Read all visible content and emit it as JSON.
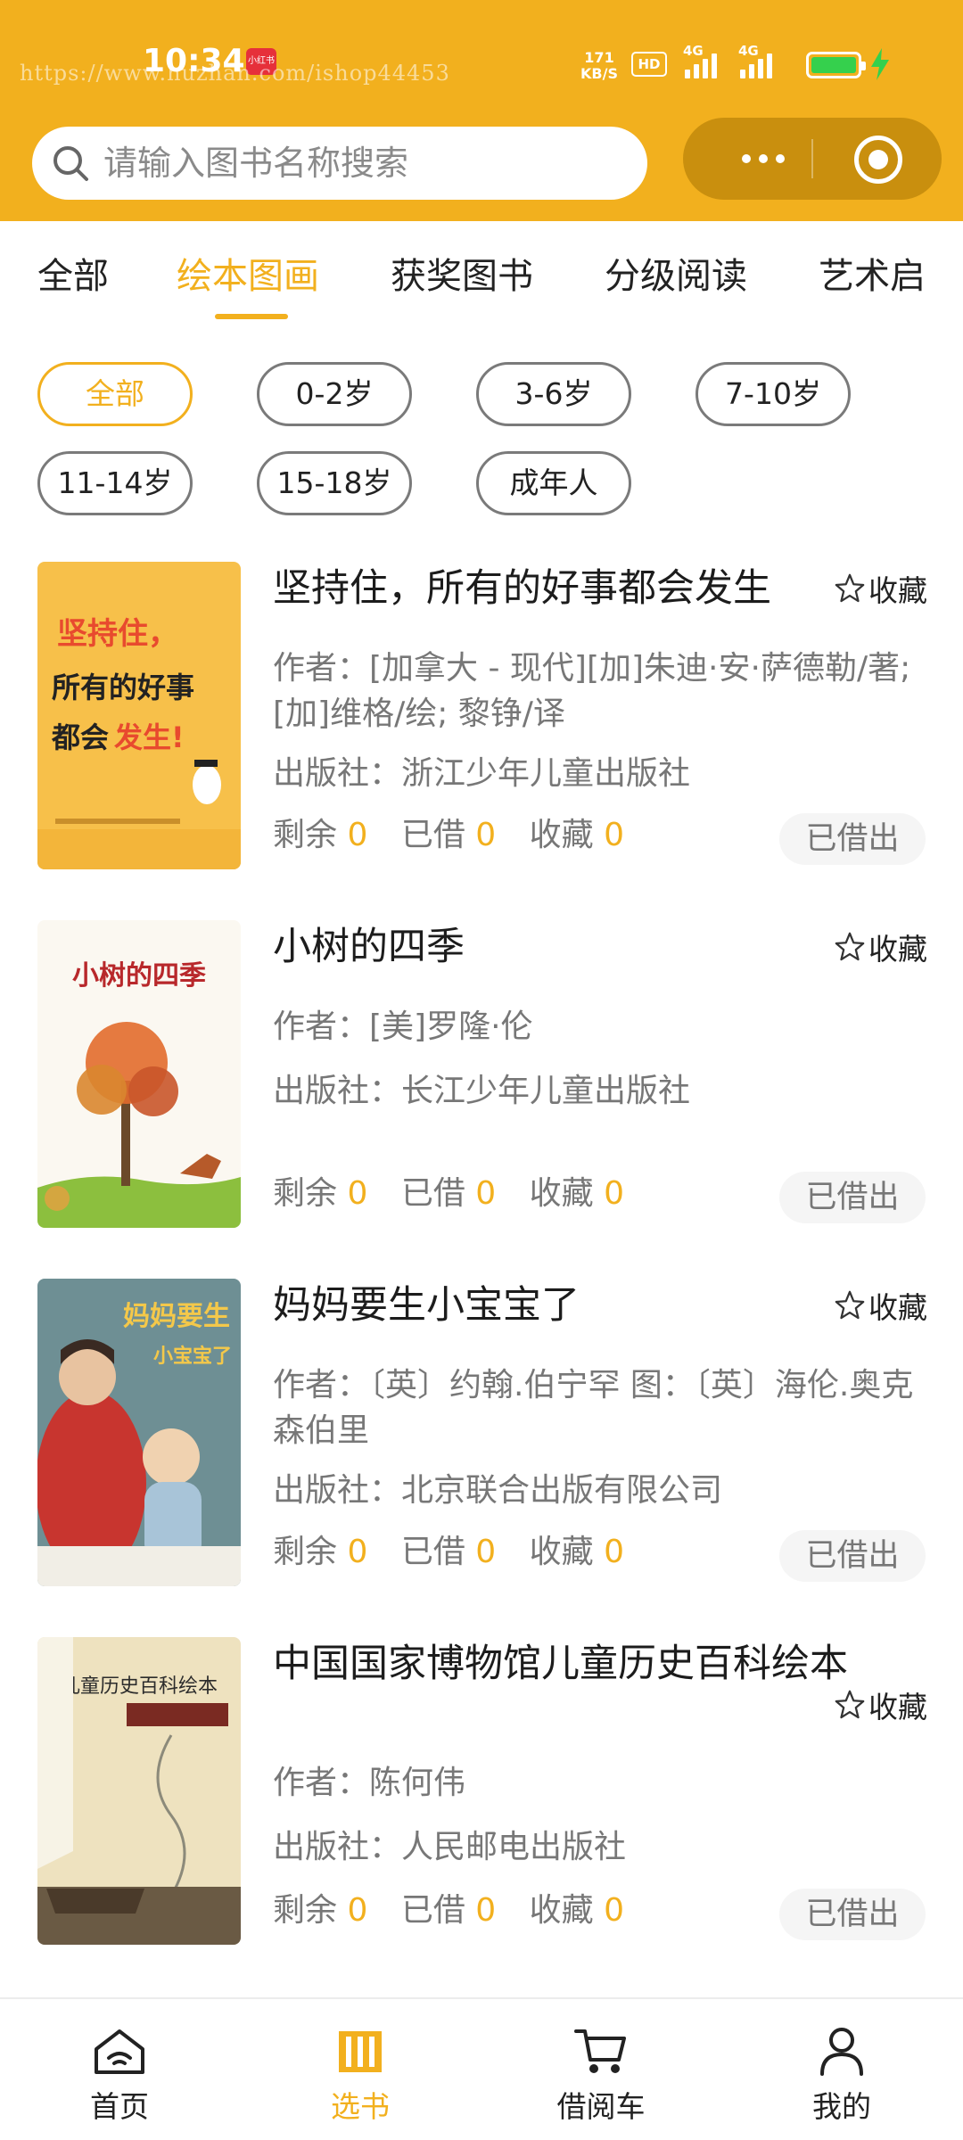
{
  "status_bar": {
    "time": "10:34",
    "app_badge": "小红书",
    "watermark": "https://www.huzhan.com/ishop44453",
    "net_speed_value": "171",
    "net_speed_unit": "KB/S",
    "hd_label": "HD",
    "signal1_label": "4G",
    "signal2_label": "4G",
    "battery_level": 1.0
  },
  "search": {
    "placeholder": "请输入图书名称搜索"
  },
  "tabs": [
    {
      "label": "全部",
      "active": false
    },
    {
      "label": "绘本图画",
      "active": true
    },
    {
      "label": "获奖图书",
      "active": false
    },
    {
      "label": "分级阅读",
      "active": false
    },
    {
      "label": "艺术启",
      "active": false
    }
  ],
  "age_filters": [
    {
      "label": "全部",
      "active": true
    },
    {
      "label": "0-2岁",
      "active": false
    },
    {
      "label": "3-6岁",
      "active": false
    },
    {
      "label": "7-10岁",
      "active": false
    },
    {
      "label": "11-14岁",
      "active": false
    },
    {
      "label": "15-18岁",
      "active": false
    },
    {
      "label": "成年人",
      "active": false
    }
  ],
  "labels": {
    "favorite": "收藏",
    "remaining": "剩余",
    "borrowed": "已借",
    "favorites": "收藏",
    "lent_out": "已借出"
  },
  "books": [
    {
      "title": "坚持住，所有的好事都会发生",
      "author": "作者：[加拿大 - 现代][加]朱迪·安·萨德勒/著; [加]维格/绘; 黎铮/译",
      "publisher": "出版社：浙江少年儿童出版社",
      "remaining": "0",
      "borrowed": "0",
      "favorites": "0",
      "cover_lines": [
        "坚持住，",
        "所有的好事",
        "都会",
        "发生!"
      ]
    },
    {
      "title": "小树的四季",
      "author": "作者：[美]罗隆·伦",
      "publisher": "出版社：长江少年儿童出版社",
      "remaining": "0",
      "borrowed": "0",
      "favorites": "0",
      "cover_lines": [
        "小树的四季"
      ]
    },
    {
      "title": "妈妈要生小宝宝了",
      "author": "作者：〔英〕约翰.伯宁罕 图：〔英〕海伦.奥克森伯里",
      "publisher": "出版社：北京联合出版有限公司",
      "remaining": "0",
      "borrowed": "0",
      "favorites": "0",
      "cover_lines": [
        "妈妈要生",
        "小宝宝了"
      ]
    },
    {
      "title": "中国国家博物馆儿童历史百科绘本",
      "author": "作者：陈何伟",
      "publisher": "出版社：人民邮电出版社",
      "remaining": "0",
      "borrowed": "0",
      "favorites": "0",
      "cover_lines": [
        "儿童历史百科绘本"
      ]
    }
  ],
  "bottom_nav": [
    {
      "label": "首页",
      "icon": "home-icon",
      "active": false
    },
    {
      "label": "选书",
      "icon": "books-icon",
      "active": true
    },
    {
      "label": "借阅车",
      "icon": "cart-icon",
      "active": false
    },
    {
      "label": "我的",
      "icon": "user-icon",
      "active": false
    }
  ],
  "colors": {
    "accent": "#f2b01e",
    "capsule": "#c98f0e",
    "text": "#222222",
    "muted": "#777777"
  }
}
